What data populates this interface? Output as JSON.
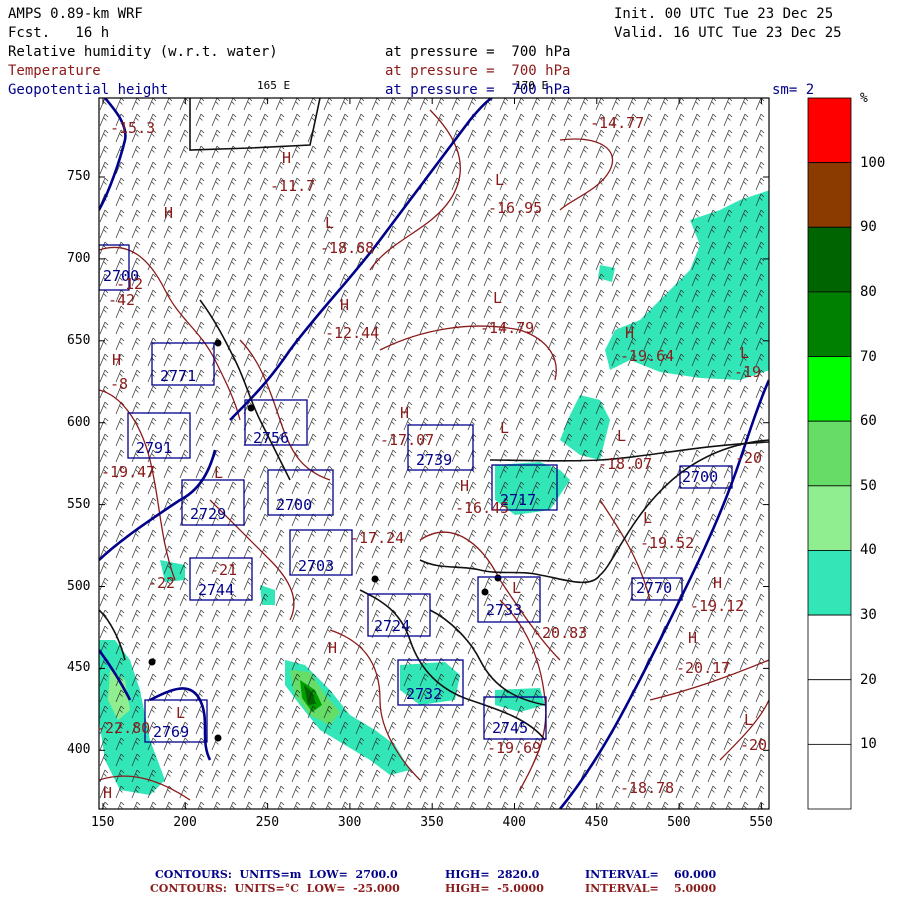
{
  "header": {
    "model": "AMPS 0.89-km WRF",
    "fcst": "Fcst.   16 h",
    "init": "Init. 00 UTC Tue 23 Dec 25",
    "valid": "Valid. 16 UTC Tue 23 Dec 25",
    "rh_label": "Relative humidity (w.r.t. water)",
    "rh_pressure": "at pressure =  700 hPa",
    "temp_label": "Temperature",
    "temp_pressure": "at pressure =  700 hPa",
    "gph_label": "Geopotential height",
    "gph_pressure": "at pressure =  700 hPa",
    "lon_label": "165 E",
    "lon_label_2": "170 E",
    "sm": "sm= 2"
  },
  "colorbar": {
    "unit": "%",
    "levels": [
      {
        "label": "100",
        "color": "#ff0000"
      },
      {
        "label": "90",
        "color": "#8b3a00"
      },
      {
        "label": "80",
        "color": "#006400"
      },
      {
        "label": "70",
        "color": "#008000"
      },
      {
        "label": "60",
        "color": "#00ff00"
      },
      {
        "label": "50",
        "color": "#66dd66"
      },
      {
        "label": "40",
        "color": "#90ee90"
      },
      {
        "label": "30",
        "color": "#33e6b8"
      },
      {
        "label": "20",
        "color": "#ffffff"
      },
      {
        "label": "10",
        "color": "#ffffff"
      },
      {
        "label": "",
        "color": "#ffffff"
      }
    ]
  },
  "axes": {
    "x_ticks": [
      "150",
      "200",
      "250",
      "300",
      "350",
      "400",
      "450",
      "500",
      "550"
    ],
    "y_ticks": [
      "750",
      "700",
      "650",
      "600",
      "550",
      "500",
      "450",
      "400"
    ]
  },
  "map_labels": {
    "height_boxes": [
      "2771",
      "2791",
      "2729",
      "2756",
      "2739",
      "2717",
      "2703",
      "2700",
      "2744",
      "2724",
      "2733",
      "2732",
      "2745",
      "2769",
      "2770",
      "2700",
      "2700"
    ],
    "temp_values": [
      "-15.3",
      "-11.7",
      "-16.95",
      "-18.68",
      "-14.77",
      "-12.44",
      "-14.79",
      "-19.64",
      "-17.07",
      "-19.47",
      "-16.45",
      "-19.52",
      "-18.07",
      "-19.12",
      "-20.83",
      "-20.17",
      "-19.69",
      "-18.78",
      "-20",
      "-19",
      "-42",
      "-12",
      "-8",
      "-22",
      "-17.24",
      "-21",
      "-22.80",
      "-20"
    ],
    "lh_markers": [
      "H",
      "L",
      "H",
      "L",
      "H",
      "L",
      "H",
      "L",
      "H",
      "L",
      "H",
      "L",
      "H",
      "L",
      "H",
      "L",
      "H",
      "L",
      "H",
      "L",
      "H",
      "L"
    ]
  },
  "footer": {
    "line1_units": "CONTOURS:  UNITS=m  LOW=  2700.0",
    "line1_high": "HIGH=  2820.0",
    "line1_int": "INTERVAL=    60.000",
    "line2_units": "CONTOURS:  UNITS=°C  LOW=  -25.000",
    "line2_high": "HIGH=  -5.0000",
    "line2_int": "INTERVAL=    5.0000"
  },
  "colors": {
    "temp": "#8b1a1a",
    "height": "#00008b",
    "rh_low": "#33e6b8",
    "rh_mid": "#00ff00",
    "rh_high": "#006400"
  }
}
